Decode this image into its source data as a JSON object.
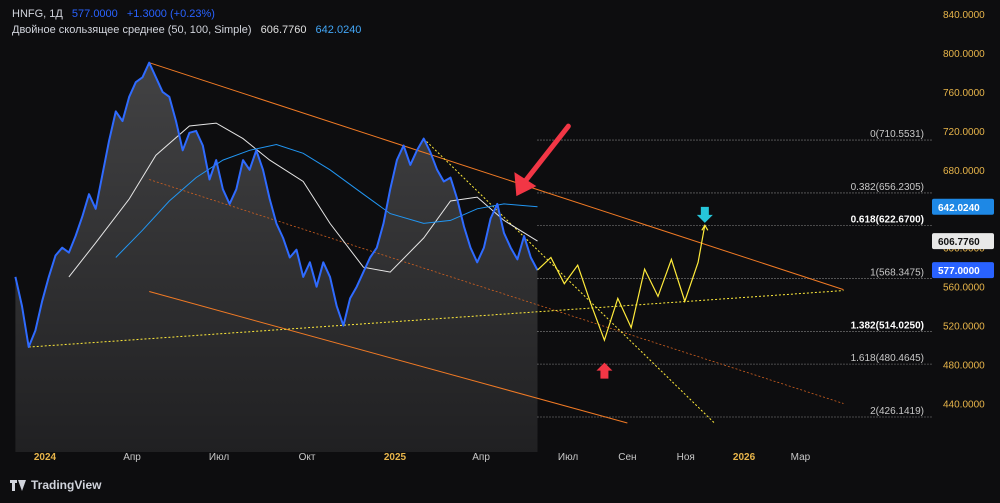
{
  "legend": {
    "symbol": "HNFG, 1Д",
    "last": "577.0000",
    "change": "+1.3000 (+0.23%)",
    "ma_label": "Двойное скользящее среднее (50, 100, Simple)",
    "ma_white": "606.7760",
    "ma_blue": "642.0240"
  },
  "brand": "TradingView",
  "colors": {
    "background": "#0d0d0f",
    "price": "#2f6bff",
    "ma_white": "#e6e6e6",
    "ma_blue": "#2196f3",
    "channel": "#f07a25",
    "forecast": "#ffeb3b",
    "fib": "#b0b0b0",
    "down_arrow": "#f23645",
    "up_arrow_red": "#f23645",
    "cyan_arrow": "#26c6da",
    "axis_text": "#e8b54a"
  },
  "chart_data": {
    "type": "line",
    "title": "",
    "xlabel": "",
    "ylabel": "",
    "ylim": [
      420,
      840
    ],
    "x_ticks": [
      "2024",
      "Апр",
      "Июл",
      "Окт",
      "2025",
      "Апр",
      "Июл",
      "Сен",
      "Ноя",
      "2026",
      "Мар"
    ],
    "y_ticks": [
      "840.0000",
      "800.0000",
      "760.0000",
      "720.0000",
      "680.0000",
      "640.0000",
      "600.0000",
      "560.0000",
      "520.0000",
      "480.0000",
      "440.0000"
    ],
    "series": [
      {
        "values": [
          [
            "2023-12-01",
            570
          ],
          [
            "2023-12-08",
            540
          ],
          [
            "2023-12-15",
            498
          ],
          [
            "2023-12-22",
            515
          ],
          [
            "2023-12-29",
            545
          ],
          [
            "2024-01-05",
            570
          ],
          [
            "2024-01-12",
            592
          ],
          [
            "2024-01-19",
            600
          ],
          [
            "2024-01-26",
            595
          ],
          [
            "2024-02-02",
            612
          ],
          [
            "2024-02-09",
            632
          ],
          [
            "2024-02-16",
            655
          ],
          [
            "2024-02-23",
            640
          ],
          [
            "2024-03-01",
            675
          ],
          [
            "2024-03-08",
            710
          ],
          [
            "2024-03-15",
            740
          ],
          [
            "2024-03-22",
            730
          ],
          [
            "2024-03-29",
            755
          ],
          [
            "2024-04-05",
            770
          ],
          [
            "2024-04-12",
            775
          ],
          [
            "2024-04-19",
            790
          ],
          [
            "2024-04-26",
            775
          ],
          [
            "2024-05-03",
            760
          ],
          [
            "2024-05-10",
            755
          ],
          [
            "2024-05-17",
            730
          ],
          [
            "2024-05-24",
            700
          ],
          [
            "2024-05-31",
            718
          ],
          [
            "2024-06-07",
            720
          ],
          [
            "2024-06-14",
            705
          ],
          [
            "2024-06-21",
            670
          ],
          [
            "2024-06-28",
            690
          ],
          [
            "2024-07-05",
            660
          ],
          [
            "2024-07-12",
            645
          ],
          [
            "2024-07-19",
            660
          ],
          [
            "2024-07-26",
            690
          ],
          [
            "2024-08-02",
            680
          ],
          [
            "2024-08-09",
            700
          ],
          [
            "2024-08-16",
            680
          ],
          [
            "2024-08-23",
            650
          ],
          [
            "2024-08-30",
            625
          ],
          [
            "2024-09-06",
            610
          ],
          [
            "2024-09-13",
            590
          ],
          [
            "2024-09-20",
            598
          ],
          [
            "2024-09-27",
            570
          ],
          [
            "2024-10-04",
            585
          ],
          [
            "2024-10-11",
            560
          ],
          [
            "2024-10-18",
            585
          ],
          [
            "2024-10-25",
            570
          ],
          [
            "2024-11-01",
            540
          ],
          [
            "2024-11-08",
            520
          ],
          [
            "2024-11-15",
            548
          ],
          [
            "2024-11-22",
            560
          ],
          [
            "2024-11-29",
            575
          ],
          [
            "2024-12-06",
            590
          ],
          [
            "2024-12-13",
            600
          ],
          [
            "2024-12-20",
            625
          ],
          [
            "2024-12-27",
            660
          ],
          [
            "2025-01-03",
            690
          ],
          [
            "2025-01-10",
            705
          ],
          [
            "2025-01-17",
            685
          ],
          [
            "2025-01-24",
            700
          ],
          [
            "2025-01-31",
            712
          ],
          [
            "2025-02-07",
            698
          ],
          [
            "2025-02-14",
            680
          ],
          [
            "2025-02-21",
            668
          ],
          [
            "2025-02-28",
            672
          ],
          [
            "2025-03-07",
            650
          ],
          [
            "2025-03-14",
            622
          ],
          [
            "2025-03-21",
            600
          ],
          [
            "2025-03-28",
            585
          ],
          [
            "2025-04-04",
            600
          ],
          [
            "2025-04-11",
            630
          ],
          [
            "2025-04-18",
            645
          ],
          [
            "2025-04-25",
            615
          ],
          [
            "2025-05-02",
            600
          ],
          [
            "2025-05-09",
            588
          ],
          [
            "2025-05-16",
            612
          ],
          [
            "2025-05-23",
            590
          ],
          [
            "2025-05-30",
            577
          ]
        ]
      },
      {
        "values": [
          [
            "2024-01-26",
            570
          ],
          [
            "2024-02-23",
            605
          ],
          [
            "2024-03-29",
            650
          ],
          [
            "2024-04-26",
            695
          ],
          [
            "2024-05-31",
            725
          ],
          [
            "2024-06-28",
            728
          ],
          [
            "2024-07-26",
            712
          ],
          [
            "2024-08-23",
            690
          ],
          [
            "2024-09-27",
            668
          ],
          [
            "2024-10-25",
            625
          ],
          [
            "2024-11-29",
            580
          ],
          [
            "2024-12-27",
            575
          ],
          [
            "2025-01-31",
            610
          ],
          [
            "2025-02-28",
            648
          ],
          [
            "2025-03-28",
            652
          ],
          [
            "2025-04-25",
            628
          ],
          [
            "2025-05-30",
            606.776
          ]
        ]
      },
      {
        "values": [
          [
            "2024-03-15",
            590
          ],
          [
            "2024-04-12",
            618
          ],
          [
            "2024-05-10",
            648
          ],
          [
            "2024-06-07",
            672
          ],
          [
            "2024-07-05",
            690
          ],
          [
            "2024-08-02",
            700
          ],
          [
            "2024-08-30",
            706
          ],
          [
            "2024-09-27",
            697
          ],
          [
            "2024-10-25",
            680
          ],
          [
            "2024-11-29",
            655
          ],
          [
            "2024-12-27",
            635
          ],
          [
            "2025-01-31",
            625
          ],
          [
            "2025-02-28",
            628
          ],
          [
            "2025-03-28",
            640
          ],
          [
            "2025-04-25",
            645
          ],
          [
            "2025-05-30",
            642.024
          ]
        ]
      },
      {
        "values": [
          [
            "2025-05-30",
            577
          ],
          [
            "2025-06-13",
            590
          ],
          [
            "2025-06-27",
            563
          ],
          [
            "2025-07-11",
            582
          ],
          [
            "2025-07-25",
            542
          ],
          [
            "2025-08-08",
            505
          ],
          [
            "2025-08-22",
            548
          ],
          [
            "2025-09-05",
            518
          ],
          [
            "2025-09-19",
            578
          ],
          [
            "2025-10-03",
            550
          ],
          [
            "2025-10-17",
            588
          ],
          [
            "2025-10-31",
            545
          ],
          [
            "2025-11-14",
            585
          ],
          [
            "2025-11-21",
            623
          ]
        ]
      }
    ],
    "fib_levels": [
      {
        "label": "0(710.5531)",
        "value": 710.5531
      },
      {
        "label": "0.382(656.2305)",
        "value": 656.2305
      },
      {
        "label": "0.618(622.6700)",
        "value": 622.67
      },
      {
        "label": "1(568.3475)",
        "value": 568.3475
      },
      {
        "label": "1.382(514.0250)",
        "value": 514.025
      },
      {
        "label": "1.618(480.4645)",
        "value": 480.4645
      },
      {
        "label": "2(426.1419)",
        "value": 426.1419
      }
    ],
    "price_tags": [
      {
        "value": 642.024,
        "text": "642.0240"
      },
      {
        "value": 606.776,
        "text": "606.7760"
      },
      {
        "value": 577.0,
        "text": "577.0000"
      }
    ],
    "annotations": [
      {
        "type": "arrow-down",
        "color": "red",
        "x": "2025-05-10",
        "y": 655
      },
      {
        "type": "arrow-up",
        "color": "red",
        "x": "2025-08-08",
        "y": 482
      },
      {
        "type": "arrow-down",
        "color": "cyan",
        "x": "2025-11-21",
        "y": 642
      }
    ],
    "trendlines": [
      {
        "name": "channel-top",
        "from": [
          "2024-04-19",
          790
        ],
        "to": [
          "2026-04-15",
          557
        ]
      },
      {
        "name": "channel-mid",
        "from": [
          "2024-04-19",
          670
        ],
        "to": [
          "2026-04-15",
          440
        ]
      },
      {
        "name": "channel-bottom",
        "from": [
          "2024-04-19",
          555
        ],
        "to": [
          "2025-09-01",
          420
        ]
      },
      {
        "name": "support-yellow",
        "from": [
          "2023-12-15",
          498
        ],
        "to": [
          "2026-04-15",
          556
        ]
      },
      {
        "name": "resistance-yellow",
        "from": [
          "2025-01-31",
          712
        ],
        "to": [
          "2025-12-01",
          420
        ]
      }
    ],
    "forecast_axis": "2025-05-30",
    "grid": false,
    "legend_position": "top-left"
  }
}
